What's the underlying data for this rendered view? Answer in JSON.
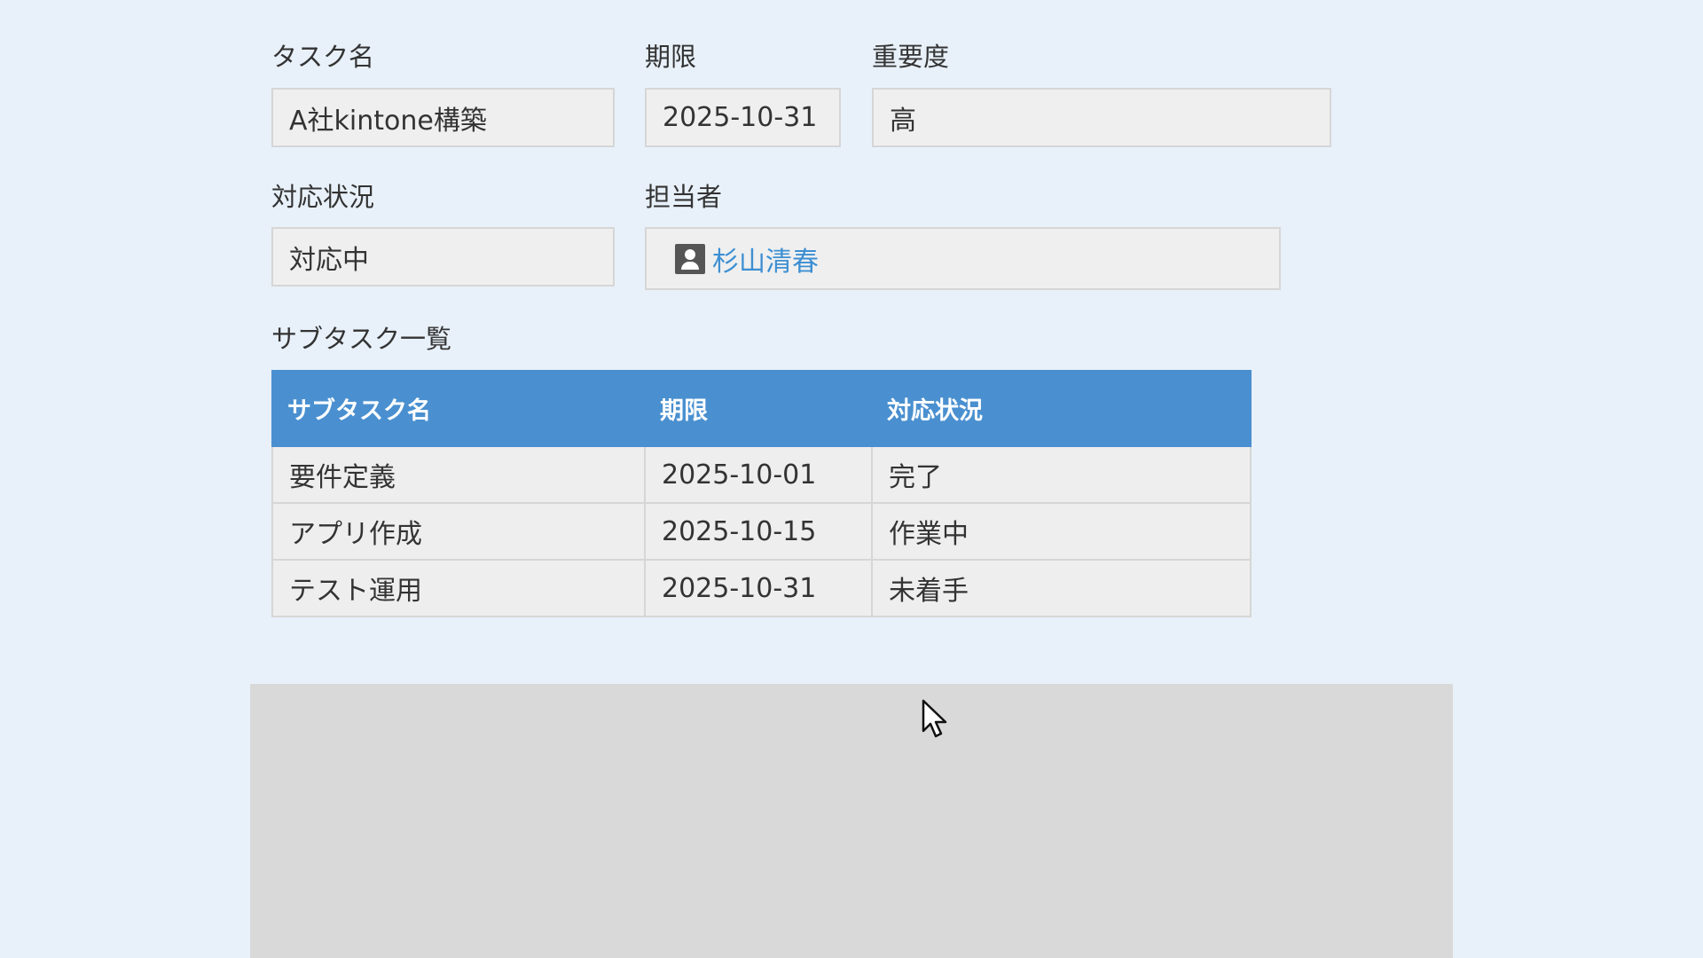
{
  "form": {
    "task_name": {
      "label": "タスク名",
      "value": "A社kintone構築"
    },
    "deadline": {
      "label": "期限",
      "value": "2025-10-31"
    },
    "importance": {
      "label": "重要度",
      "value": "高"
    },
    "status": {
      "label": "対応状況",
      "value": "対応中"
    },
    "assignee": {
      "label": "担当者",
      "value": "杉山清春",
      "icon": "user-icon"
    }
  },
  "subtasks": {
    "label": "サブタスク一覧",
    "headers": [
      "サブタスク名",
      "期限",
      "対応状況"
    ],
    "rows": [
      [
        "要件定義",
        "2025-10-01",
        "完了"
      ],
      [
        "アプリ作成",
        "2025-10-15",
        "作業中"
      ],
      [
        "テスト運用",
        "2025-10-31",
        "未着手"
      ]
    ]
  },
  "colors": {
    "background": "#e8f1fa",
    "table_header": "#4a90d0",
    "link": "#3d8fd3",
    "field_bg": "#efefef",
    "panel": "#d8d9d8"
  }
}
